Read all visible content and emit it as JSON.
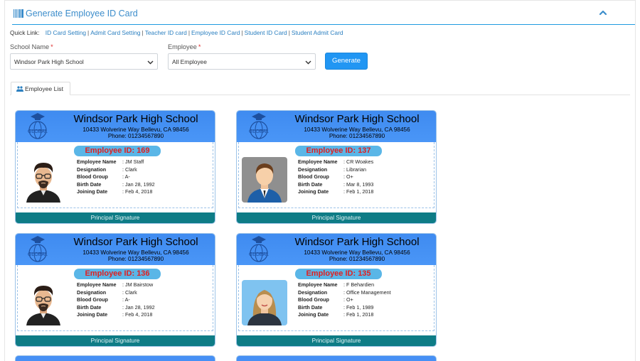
{
  "header": {
    "title": "Generate Employee ID Card"
  },
  "quick_links": {
    "label": "Quick Link:",
    "items": [
      "ID Card Setting",
      "Admit Card Setting",
      "Teacher ID card",
      "Employee ID Card",
      "Student ID Card",
      "Student Admit Card"
    ]
  },
  "form": {
    "school_label": "School Name",
    "school_value": "Windsor Park High School",
    "employee_label": "Employee",
    "employee_value": "All Employee",
    "required_mark": "*",
    "generate_label": "Generate"
  },
  "tabs": [
    {
      "label": "Employee List"
    }
  ],
  "field_labels": {
    "name": "Employee Name",
    "designation": "Designation",
    "blood": "Blood Group",
    "birth": "Birth Date",
    "joining": "Joining Date"
  },
  "cards": [
    {
      "school": "Windsor Park High School",
      "address": "10433 Wolverine Way Bellevu, CA 98456",
      "phone": "Phone: 01234567890",
      "logo_text": "GLOBAL",
      "id_label": "Employee ID: 169",
      "name": "JM Staff",
      "designation": "Clark",
      "blood": "A-",
      "birth": "Jan 28, 1992",
      "joining": "Feb 4, 2018",
      "signature": "Principal Signature",
      "avatar": "man-beard-avatar"
    },
    {
      "school": "Windsor Park High School",
      "address": "10433 Wolverine Way Bellevu, CA 98456",
      "phone": "Phone: 01234567890",
      "logo_text": "GLOBAL",
      "id_label": "Employee ID: 137",
      "name": "CR Woakes",
      "designation": "Librarian",
      "blood": "O+",
      "birth": "Mar 8, 1993",
      "joining": "Feb 1, 2018",
      "signature": "Principal Signature",
      "avatar": "man-suit-avatar"
    },
    {
      "school": "Windsor Park High School",
      "address": "10433 Wolverine Way Bellevu, CA 98456",
      "phone": "Phone: 01234567890",
      "logo_text": "GLOBAL",
      "id_label": "Employee ID: 136",
      "name": "JM Bairstow",
      "designation": "Clark",
      "blood": "A-",
      "birth": "Jan 28, 1992",
      "joining": "Feb 4, 2018",
      "signature": "Principal Signature",
      "avatar": "man-beard-avatar"
    },
    {
      "school": "Windsor Park High School",
      "address": "10433 Wolverine Way Bellevu, CA 98456",
      "phone": "Phone: 01234567890",
      "logo_text": "GLOBAL",
      "id_label": "Employee ID: 135",
      "name": "F Behardien",
      "designation": "Office Management",
      "blood": "O+",
      "birth": "Feb 1, 1989",
      "joining": "Feb 1, 2018",
      "signature": "Principal Signature",
      "avatar": "woman-avatar"
    }
  ],
  "colors": {
    "accent": "#3c8dcb",
    "button": "#2196f3",
    "card_header": "#4690f5",
    "card_footer": "#0e7c86",
    "id_pill": "#5ab6e7",
    "id_text": "#e02020"
  }
}
